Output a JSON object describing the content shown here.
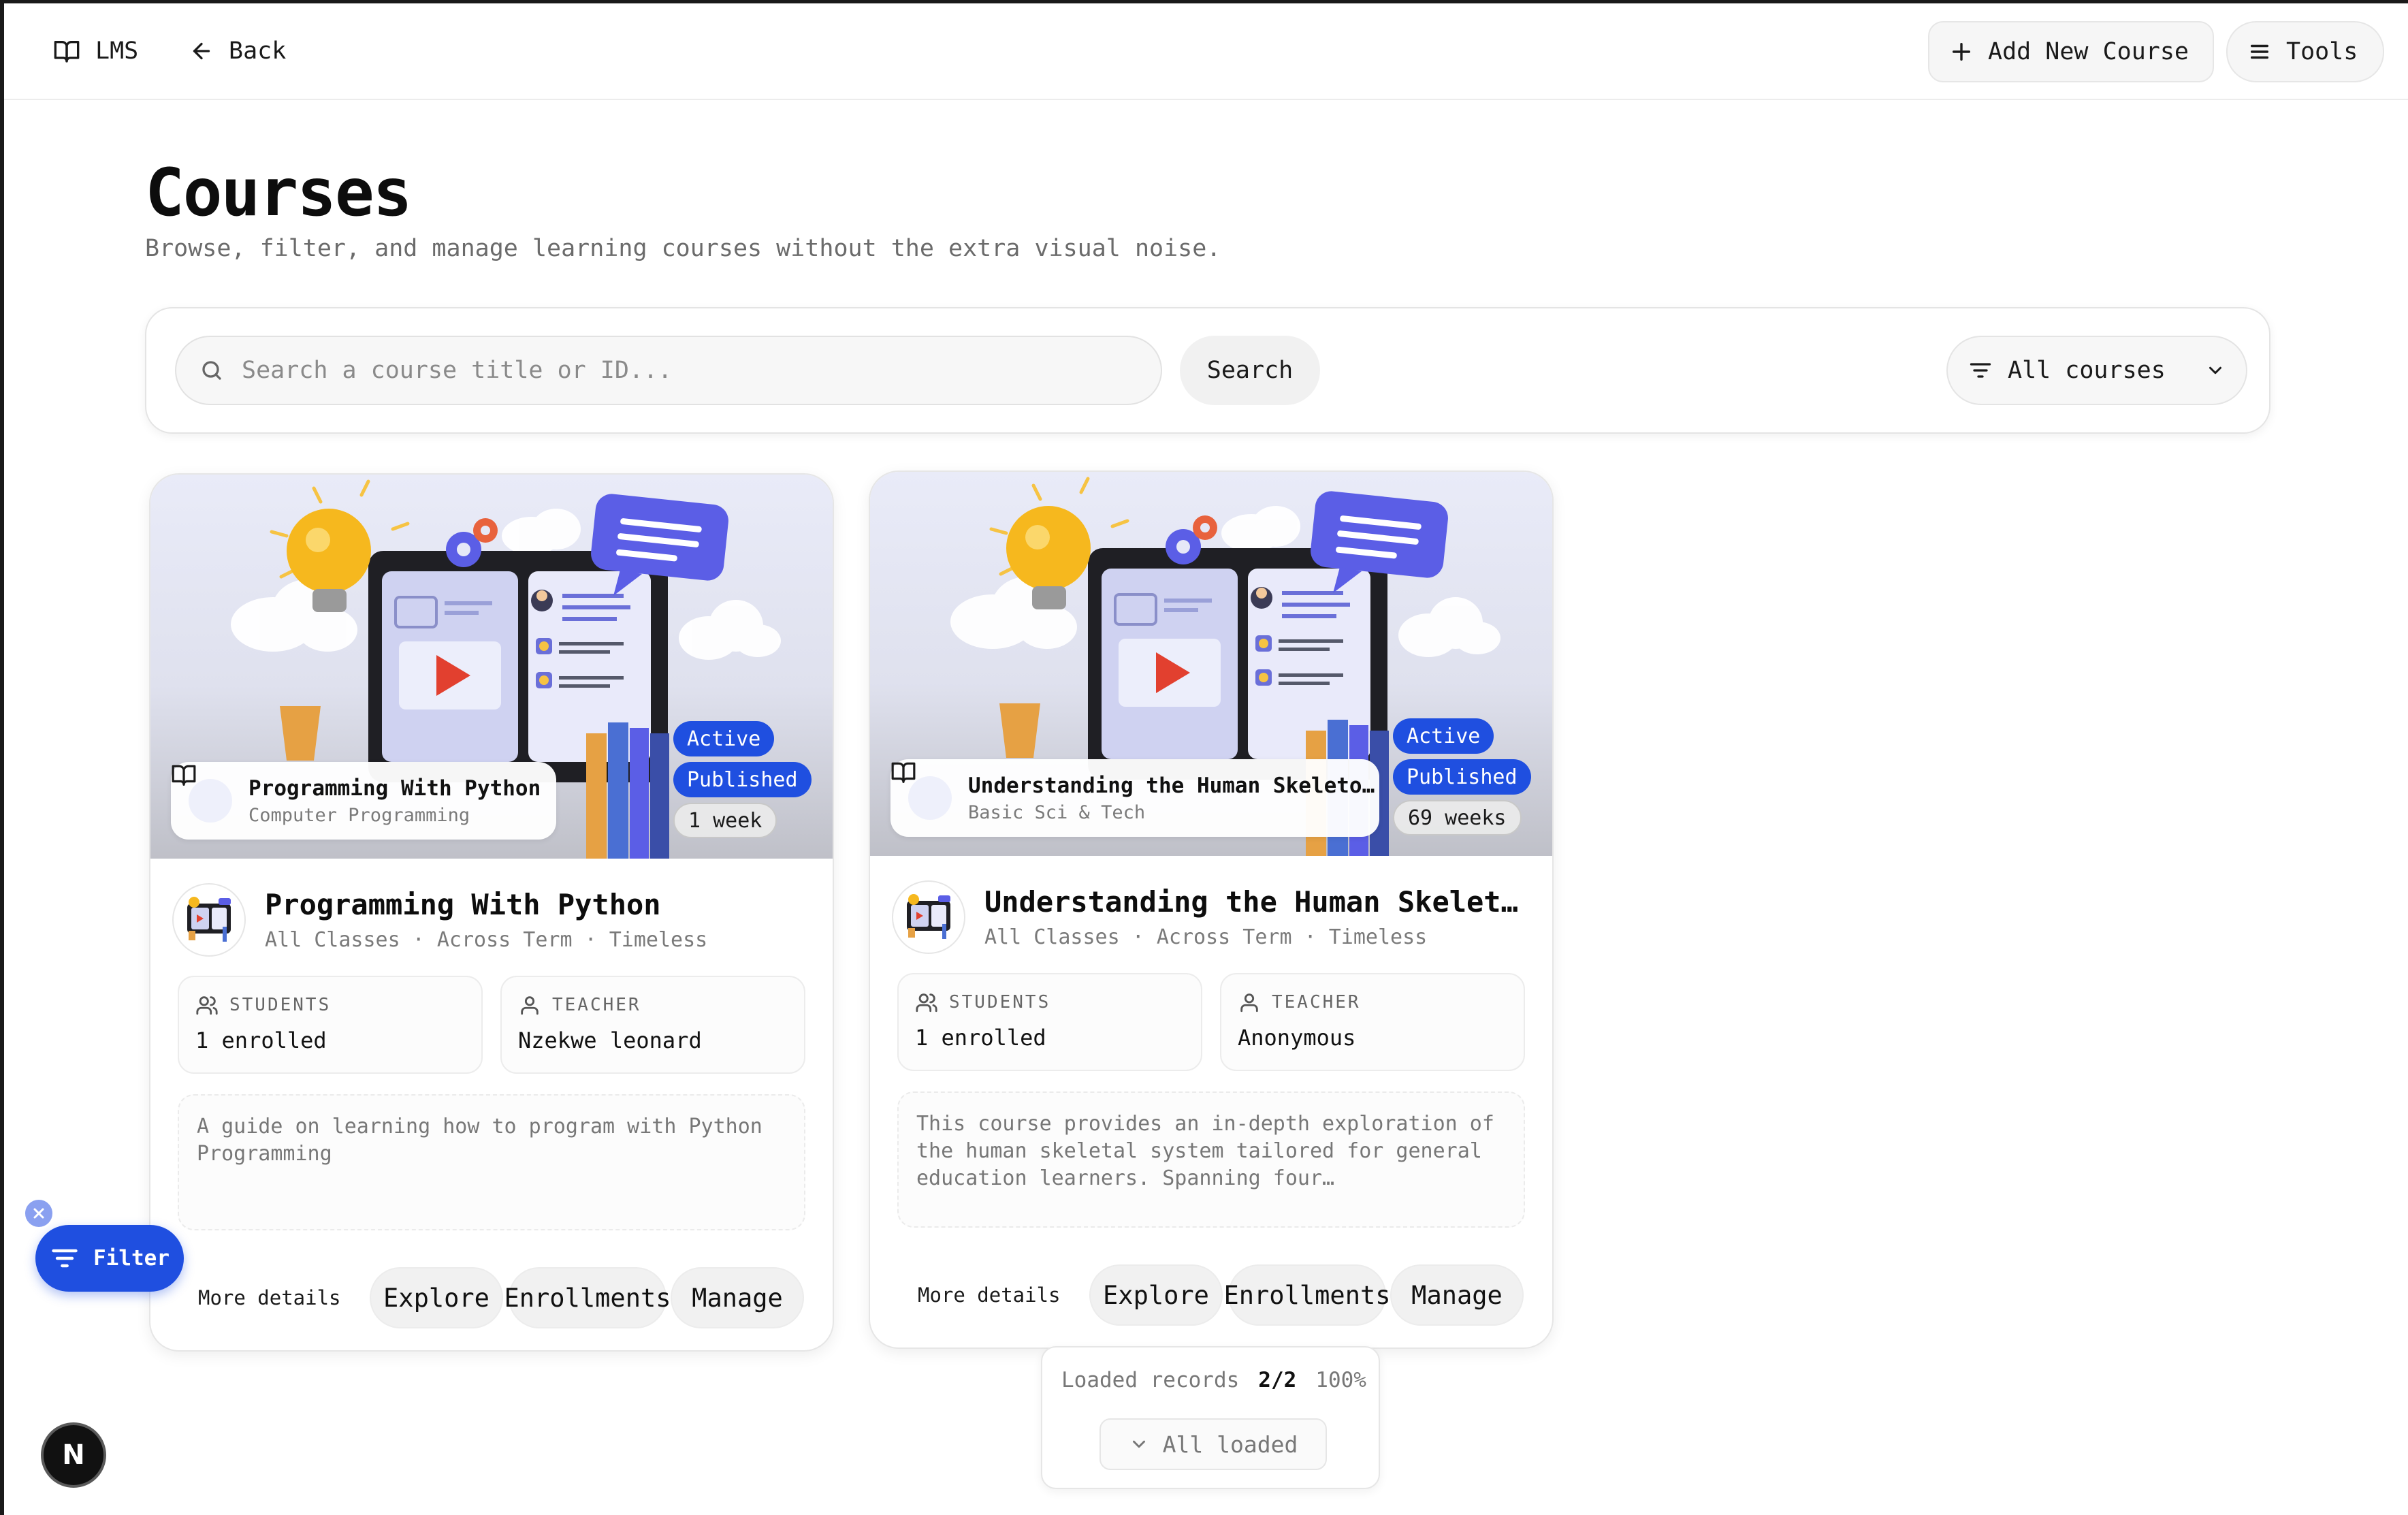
{
  "nav": {
    "brand": "LMS",
    "back": "Back",
    "add_course": "Add New Course",
    "tools": "Tools"
  },
  "header": {
    "title": "Courses",
    "subtitle": "Browse, filter, and manage learning courses without the extra visual noise."
  },
  "search": {
    "placeholder": "Search a course title or ID...",
    "value": "",
    "button": "Search",
    "filter_selected": "All courses"
  },
  "courses": [
    {
      "title": "Programming With Python",
      "category": "Computer Programming",
      "status": "Active",
      "visibility": "Published",
      "duration": "1 week",
      "classes": "All Classes",
      "term": "Across Term",
      "timing": "Timeless",
      "students_label": "STUDENTS",
      "students": "1 enrolled",
      "teacher_label": "TEACHER",
      "teacher": "Nzekwe leonard",
      "description": "A guide on learning how to program with Python Programming",
      "more": "More details",
      "explore": "Explore",
      "enrollments": "Enrollments",
      "manage": "Manage"
    },
    {
      "title": "Understanding the Human Skeleton…",
      "category": "Basic Sci & Tech",
      "status": "Active",
      "visibility": "Published",
      "duration": "69 weeks",
      "classes": "All Classes",
      "term": "Across Term",
      "timing": "Timeless",
      "students_label": "STUDENTS",
      "students": "1 enrolled",
      "teacher_label": "TEACHER",
      "teacher": "Anonymous",
      "description": "This course provides an in-depth exploration of the human skeletal system tailored for general education learners. Spanning four comprehensive…",
      "more": "More details",
      "explore": "Explore",
      "enrollments": "Enrollments",
      "manage": "Manage"
    }
  ],
  "meta_separator": "·",
  "loader": {
    "label": "Loaded records",
    "count": "2/2",
    "percent": "100%",
    "button": "All loaded"
  },
  "fab": {
    "label": "Filter"
  },
  "dev_badge": "N",
  "colors": {
    "accent": "#1f4fe0",
    "text": "#111111",
    "muted": "#7a7a7a",
    "border": "#e6e6e6"
  },
  "icons": [
    "book-open-icon",
    "arrow-left-icon",
    "plus-icon",
    "menu-icon",
    "search-icon",
    "filter-lines-icon",
    "chevron-down-icon",
    "users-icon",
    "user-icon",
    "close-icon"
  ]
}
